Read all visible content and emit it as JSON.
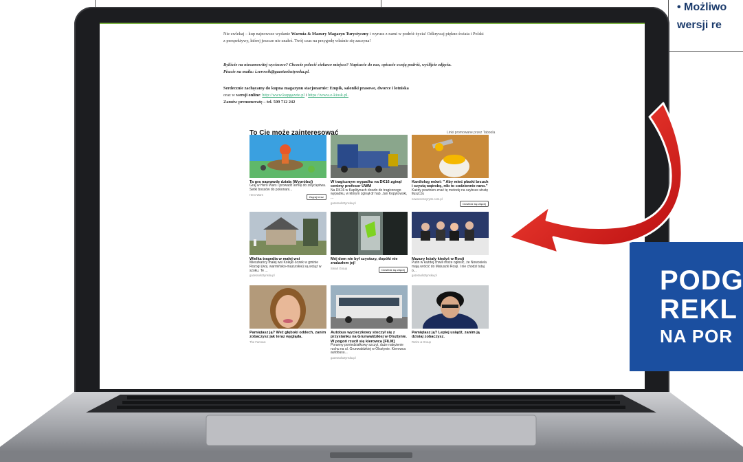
{
  "top_right": {
    "line1": "• Możliwo",
    "line2": "wersji re"
  },
  "article": {
    "p1_line1_a": "Nie zwlekaj – kup najnowsze wydanie ",
    "p1_line1_b": "Warmia & Mazury Magazyn Turystyczny",
    "p1_line1_c": " i wyrusz z nami w podróż życia! Odkrywaj piękno świata i Polski",
    "p1_line2": "z perspektywy, której jeszcze nie znałeś. Twój czas na przygodę właśnie się zaczyna!",
    "p2_line1": "Byliście na niesamowitej wycieczce? Chcecie polecić ciekawe miejsce? Napiszcie do nas, opiszcie swoją podróż, wyślijcie zdjęcia.",
    "p2_line2": "Piszcie na maila: i.serowik@gazetaolsztynska.pl.",
    "p3_line1": "Serdecznie zachęcamy do kupna magazynu stacjonarnie: Empik, saloniki prasowe, dworce i lotniska",
    "p3_line2_a": "oraz w ",
    "p3_line2_b": "wersji online",
    "p3_line2_c": ": ",
    "p3_link1": "http://www.kupgazete.pl",
    "p3_line2_d": " i ",
    "p3_link2": "https://www.e-kiosk.pl.",
    "p4": "Zamów prenumeratę – tel. 509 712 242"
  },
  "recommend": {
    "title": "To Cię może zainteresować",
    "note": "Linki promowane przez Taboola",
    "cards": [
      {
        "title": "Ta gra naprawdę działa (Wypróbuj)",
        "desc": "Graj w Hero Wars i prowadź armię do zwycięstwa. Setki bossów do pokonani...",
        "source": "Hero Wars",
        "button": "Zagraj teraz"
      },
      {
        "title": "W tragicznym wypadku na DK16 zginął cenimy profesor UWM",
        "desc": "Na DK16 w Kaplitynach doszło do tragicznego wypadku, w którym zginął dr hab. Jan Kopytowski, ...",
        "source": "gazetaolsztynska.pl",
        "button": ""
      },
      {
        "title": "Kardiolog mówi: \" Aby mieć płaski brzuch i czystą wątrobę, rób to codziennie rano.\"",
        "desc": "Każdy powinien znać tę metodę na szybsze utratę tłuszczu",
        "source": "nowoczesnyrytm.com.pl",
        "button": "Dowiedz się więcej"
      },
      {
        "title": "Wielka tragedia w małej wsi",
        "desc": "Mieszkańcy małej wsi Kolejki Łozek w gminie Rozogi (woj. warmińsko-mazurskie) są wciąż w szoku. Te ...",
        "source": "gazetaolsztynska.pl",
        "button": ""
      },
      {
        "title": "Mój dom nie był czystszy, dopóki nie znalazłem jej!",
        "desc": "",
        "source": "Smart Group",
        "button": "Dowiedz się więcej"
      },
      {
        "title": "Mazury leżały kiedyś w Rosji",
        "desc": "Putin w każdej chwili może ogłosić, że Nowosiela mają wrócić do Matuszki Rosji. I nie chodzi tutaj o...",
        "source": "gazetaolsztynska.pl",
        "button": ""
      },
      {
        "title": "Pamiętasz ją? Weź głęboki oddech, zanim zobaczysz jak teraz wygląda.",
        "desc": "",
        "source": "The Famous",
        "button": ""
      },
      {
        "title": "Autobus wycieczkowy stoczył się z przystanku na Grunwaldzkiej w Olsztynie. W pogoń rzucił się kierowca [FILM]",
        "desc": "Poranny poniedziałkowy szczyt, duże natężenie ruchu na ul. Grunwaldzkiej w Olsztynie. Kierowca autobusu...",
        "source": "gazetaolsztynska.pl",
        "button": ""
      },
      {
        "title": "Pamiętasz ją? Lepiej usiądź, zanim ją dzisiaj zobaczysz.",
        "desc": "",
        "source": "Retire & Group",
        "button": ""
      }
    ]
  },
  "billboard": {
    "line1": "PODG",
    "line2": "REKL",
    "line3": "NA POR"
  },
  "colors": {
    "accent_green": "#7cb342",
    "billboard_blue": "#1b4fa0",
    "arrow_red": "#e0191a"
  }
}
